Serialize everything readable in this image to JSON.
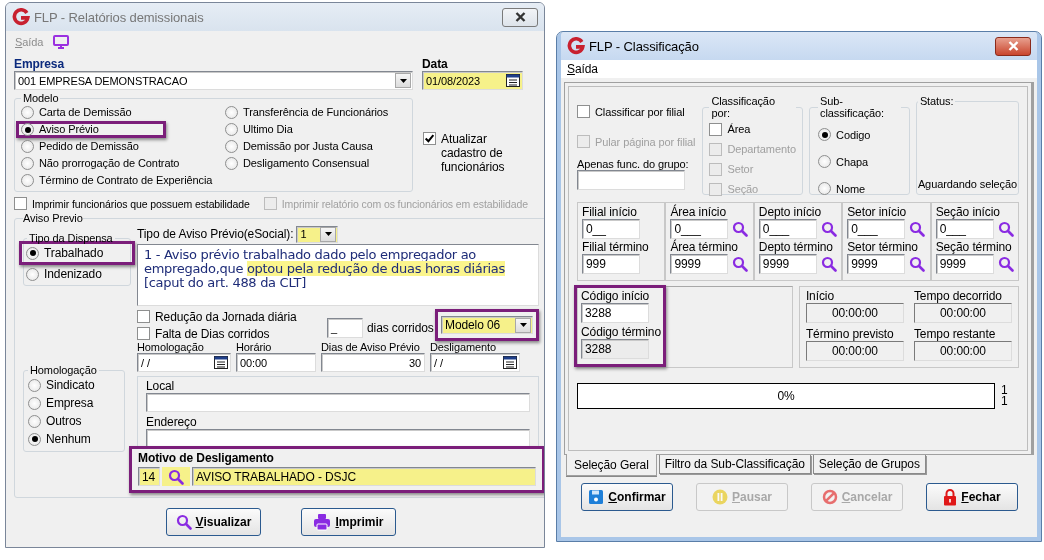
{
  "report_window": {
    "title": "FLP - Relatórios demissionais",
    "active": false,
    "menu": [
      {
        "label": "Saída",
        "disabled": true
      }
    ],
    "empresa": {
      "label": "Empresa",
      "value": "001 EMPRESA DEMONSTRACAO"
    },
    "data": {
      "label": "Data",
      "value": "01/08/2023"
    },
    "modelo": {
      "label": "Modelo",
      "options": [
        {
          "label": "Carta de Demissão",
          "selected": false,
          "highlighted": false
        },
        {
          "label": "Aviso Prévio",
          "selected": true,
          "highlighted": true
        },
        {
          "label": "Pedido de Demissão",
          "selected": false,
          "highlighted": false
        },
        {
          "label": "Não prorrogação de Contrato",
          "selected": false,
          "highlighted": false
        },
        {
          "label": "Término de Contrato de Experiência",
          "selected": false,
          "highlighted": false
        },
        {
          "label": "Transferência de Funcionários",
          "selected": false,
          "highlighted": false
        },
        {
          "label": "Ultimo Dia",
          "selected": false,
          "highlighted": false
        },
        {
          "label": "Demissão por Justa Causa",
          "selected": false,
          "highlighted": false
        },
        {
          "label": "Desligamento Consensual",
          "selected": false,
          "highlighted": false
        }
      ]
    },
    "atualizar": {
      "label": "Atualizar cadastro de funcionários",
      "checked": true,
      "disabled": false
    },
    "estabilidade": [
      {
        "label": "Imprimir funcionários que possuem estabilidade",
        "checked": false,
        "disabled": false
      },
      {
        "label": "Imprimir relatório com os funcionários em estabilidade",
        "checked": false,
        "disabled": true
      }
    ],
    "aviso_previo": {
      "label": "Aviso Previo",
      "tipo_dispensa": {
        "label": "Tipo da Dispensa",
        "options": [
          {
            "label": "Trabalhado",
            "selected": true,
            "highlighted": true
          },
          {
            "label": "Indenizado",
            "selected": false,
            "highlighted": false
          }
        ]
      },
      "tipo_esocial": {
        "label": "Tipo de Aviso Prévio(eSocial):",
        "value": "1"
      },
      "description": [
        {
          "text": "1 - Aviso prévio trabalhado dado pelo empregador ao empregado,que ",
          "marked": false
        },
        {
          "text": "optou pela redução de duas horas diárias",
          "marked": true
        },
        {
          "text": " [caput do art. 488 da CLT]",
          "marked": false
        }
      ],
      "checks": [
        {
          "label": "Redução da Jornada diária",
          "checked": false,
          "disabled": false
        },
        {
          "label": "Falta de Dias corridos",
          "checked": false,
          "disabled": false
        }
      ],
      "dias": {
        "value": "_",
        "label": "dias corridos"
      },
      "modelo_select": {
        "value": "Modelo 06",
        "highlighted": true
      },
      "fields": [
        {
          "label": "Homologação",
          "value": "/ /",
          "kind": "date"
        },
        {
          "label": "Horário",
          "value": "00:00",
          "kind": "text"
        },
        {
          "label": "Dias de Aviso Prévio",
          "value": "30",
          "kind": "number"
        },
        {
          "label": "Desligamento",
          "value": "/ /",
          "kind": "date"
        }
      ],
      "homologacao": {
        "label": "Homologação",
        "options": [
          {
            "label": "Sindicato",
            "selected": false
          },
          {
            "label": "Empresa",
            "selected": false
          },
          {
            "label": "Outros",
            "selected": false
          },
          {
            "label": "Nenhum",
            "selected": true
          }
        ]
      },
      "local": {
        "label": "Local"
      },
      "endereco": {
        "label": "Endereço"
      },
      "motivo": {
        "label": "Motivo de Desligamento",
        "code": "14",
        "description": "AVISO TRABALHADO - DSJC",
        "highlighted": true
      }
    },
    "buttons": [
      {
        "label": "Visualizar",
        "kind": "search",
        "disabled": false
      },
      {
        "label": "Imprimir",
        "kind": "print",
        "disabled": false
      }
    ]
  },
  "class_window": {
    "title": "FLP - Classificação",
    "active": true,
    "menu": [
      {
        "label": "Saída",
        "disabled": false
      }
    ],
    "classificar": {
      "label": "Classificar por filial",
      "checked": false,
      "disabled": false
    },
    "pular": {
      "label": "Pular página por filial",
      "checked": false,
      "disabled": true
    },
    "apenas": {
      "label": "Apenas func. do grupo:"
    },
    "classificacao": {
      "label": "Classificação por:",
      "options": [
        {
          "label": "Área",
          "checked": false,
          "disabled": false
        },
        {
          "label": "Departamento",
          "checked": false,
          "disabled": true
        },
        {
          "label": "Setor",
          "checked": false,
          "disabled": true
        },
        {
          "label": "Seção",
          "checked": false,
          "disabled": true
        }
      ]
    },
    "sub": {
      "label": "Sub-classificação:",
      "options": [
        {
          "label": "Codigo",
          "selected": true
        },
        {
          "label": "Chapa",
          "selected": false
        },
        {
          "label": "Nome",
          "selected": false
        }
      ]
    },
    "status": {
      "label": "Status:",
      "text": "Aguardando seleção"
    },
    "ranges": [
      {
        "start_label": "Filial início",
        "start_value": "0__",
        "end_label": "Filial término",
        "end_value": "999",
        "lookup": false
      },
      {
        "start_label": "Área início",
        "start_value": "0___",
        "end_label": "Área término",
        "end_value": "9999",
        "lookup": true
      },
      {
        "start_label": "Depto início",
        "start_value": "0___",
        "end_label": "Depto término",
        "end_value": "9999",
        "lookup": true
      },
      {
        "start_label": "Setor início",
        "start_value": "0___",
        "end_label": "Setor término",
        "end_value": "9999",
        "lookup": true
      },
      {
        "start_label": "Seção início",
        "start_value": "0___",
        "end_label": "Seção término",
        "end_value": "9999",
        "lookup": true
      }
    ],
    "codigo": {
      "start_label": "Código início",
      "start_value": "3288",
      "end_label": "Código término",
      "end_value": "3288",
      "highlighted": true
    },
    "timers": [
      {
        "label": "Início",
        "value": "00:00:00"
      },
      {
        "label": "Tempo decorrido",
        "value": "00:00:00"
      },
      {
        "label": "Término previsto",
        "value": "00:00:00"
      },
      {
        "label": "Tempo restante",
        "value": "00:00:00"
      }
    ],
    "progress": {
      "level": 0,
      "text": "0%",
      "counts": [
        "1",
        "1"
      ]
    },
    "tabs": [
      {
        "label": "Seleção Geral",
        "selected": true
      },
      {
        "label": "Filtro da Sub-Classificação",
        "selected": false
      },
      {
        "label": "Seleção de Grupos",
        "selected": false
      }
    ],
    "buttons": [
      {
        "label": "Confirmar",
        "kind": "save",
        "disabled": false
      },
      {
        "label": "Pausar",
        "kind": "pause",
        "disabled": true
      },
      {
        "label": "Cancelar",
        "kind": "cancel",
        "disabled": true
      },
      {
        "label": "Fechar",
        "kind": "lock",
        "disabled": false
      }
    ]
  }
}
